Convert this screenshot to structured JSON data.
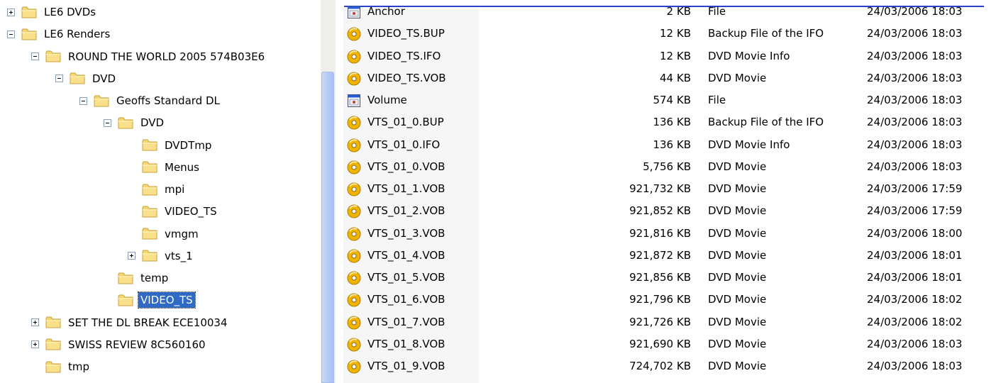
{
  "tree": {
    "nodes": [
      {
        "label": "LE6 DVDs",
        "expander": "plus",
        "depth": 0
      },
      {
        "label": "LE6 Renders",
        "expander": "minus",
        "depth": 0
      },
      {
        "label": "ROUND THE WORLD 2005 574B03E6",
        "expander": "minus",
        "depth": 1
      },
      {
        "label": "DVD",
        "expander": "minus",
        "depth": 2
      },
      {
        "label": "Geoffs Standard DL",
        "expander": "minus",
        "depth": 3
      },
      {
        "label": "DVD",
        "expander": "minus",
        "depth": 4
      },
      {
        "label": "DVDTmp",
        "expander": "none",
        "depth": 5
      },
      {
        "label": "Menus",
        "expander": "none",
        "depth": 5
      },
      {
        "label": "mpi",
        "expander": "none",
        "depth": 5
      },
      {
        "label": "VIDEO_TS",
        "expander": "none",
        "depth": 5
      },
      {
        "label": "vmgm",
        "expander": "none",
        "depth": 5
      },
      {
        "label": "vts_1",
        "expander": "plus",
        "depth": 5
      },
      {
        "label": "temp",
        "expander": "none",
        "depth": 4
      },
      {
        "label": "VIDEO_TS",
        "expander": "none",
        "depth": 4,
        "selected": true
      },
      {
        "label": "SET THE DL BREAK ECE10034",
        "expander": "plus",
        "depth": 1
      },
      {
        "label": "SWISS REVIEW 8C560160",
        "expander": "plus",
        "depth": 1
      },
      {
        "label": "tmp",
        "expander": "none",
        "depth": 1
      }
    ]
  },
  "files": [
    {
      "name": "Anchor",
      "size": "2 KB",
      "type": "File",
      "modified": "24/03/2006 18:03",
      "icon": "generic-file-icon"
    },
    {
      "name": "VIDEO_TS.BUP",
      "size": "12 KB",
      "type": "Backup File of the IFO",
      "modified": "24/03/2006 18:03",
      "icon": "dvd-disc-icon"
    },
    {
      "name": "VIDEO_TS.IFO",
      "size": "12 KB",
      "type": "DVD Movie Info",
      "modified": "24/03/2006 18:03",
      "icon": "dvd-disc-icon"
    },
    {
      "name": "VIDEO_TS.VOB",
      "size": "44 KB",
      "type": "DVD Movie",
      "modified": "24/03/2006 18:03",
      "icon": "dvd-disc-icon"
    },
    {
      "name": "Volume",
      "size": "574 KB",
      "type": "File",
      "modified": "24/03/2006 18:03",
      "icon": "generic-file-icon"
    },
    {
      "name": "VTS_01_0.BUP",
      "size": "136 KB",
      "type": "Backup File of the IFO",
      "modified": "24/03/2006 18:03",
      "icon": "dvd-disc-icon"
    },
    {
      "name": "VTS_01_0.IFO",
      "size": "136 KB",
      "type": "DVD Movie Info",
      "modified": "24/03/2006 18:03",
      "icon": "dvd-disc-icon"
    },
    {
      "name": "VTS_01_0.VOB",
      "size": "5,756 KB",
      "type": "DVD Movie",
      "modified": "24/03/2006 18:03",
      "icon": "dvd-disc-icon"
    },
    {
      "name": "VTS_01_1.VOB",
      "size": "921,732 KB",
      "type": "DVD Movie",
      "modified": "24/03/2006 17:59",
      "icon": "dvd-disc-icon"
    },
    {
      "name": "VTS_01_2.VOB",
      "size": "921,852 KB",
      "type": "DVD Movie",
      "modified": "24/03/2006 17:59",
      "icon": "dvd-disc-icon"
    },
    {
      "name": "VTS_01_3.VOB",
      "size": "921,816 KB",
      "type": "DVD Movie",
      "modified": "24/03/2006 18:00",
      "icon": "dvd-disc-icon"
    },
    {
      "name": "VTS_01_4.VOB",
      "size": "921,872 KB",
      "type": "DVD Movie",
      "modified": "24/03/2006 18:01",
      "icon": "dvd-disc-icon"
    },
    {
      "name": "VTS_01_5.VOB",
      "size": "921,856 KB",
      "type": "DVD Movie",
      "modified": "24/03/2006 18:01",
      "icon": "dvd-disc-icon"
    },
    {
      "name": "VTS_01_6.VOB",
      "size": "921,796 KB",
      "type": "DVD Movie",
      "modified": "24/03/2006 18:02",
      "icon": "dvd-disc-icon"
    },
    {
      "name": "VTS_01_7.VOB",
      "size": "921,726 KB",
      "type": "DVD Movie",
      "modified": "24/03/2006 18:02",
      "icon": "dvd-disc-icon"
    },
    {
      "name": "VTS_01_8.VOB",
      "size": "921,690 KB",
      "type": "DVD Movie",
      "modified": "24/03/2006 18:03",
      "icon": "dvd-disc-icon"
    },
    {
      "name": "VTS_01_9.VOB",
      "size": "724,702 KB",
      "type": "DVD Movie",
      "modified": "24/03/2006 18:03",
      "icon": "dvd-disc-icon"
    }
  ],
  "colors": {
    "selection": "#316ac5",
    "folder": "#f5d670",
    "scrollbar_thumb": "#b8ccf4",
    "header_line": "#2b3fcb",
    "dvd_disc": "#f0b400"
  }
}
